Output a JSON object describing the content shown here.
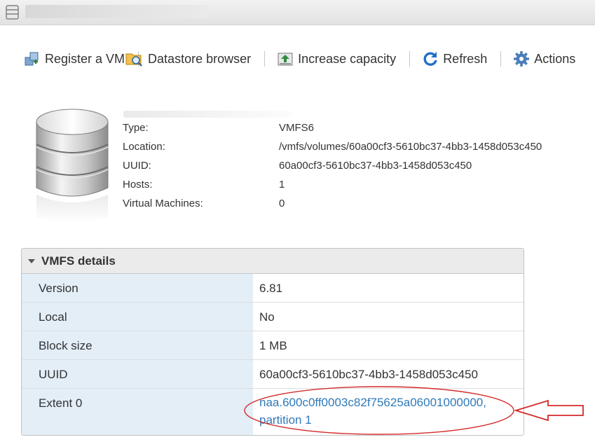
{
  "toolbar": {
    "register_vm": "Register a VM",
    "datastore_browser": "Datastore browser",
    "increase_capacity": "Increase capacity",
    "refresh": "Refresh",
    "actions": "Actions"
  },
  "summary": {
    "type_label": "Type:",
    "type_value": "VMFS6",
    "location_label": "Location:",
    "location_value": "/vmfs/volumes/60a00cf3-5610bc37-4bb3-1458d053c450",
    "uuid_label": "UUID:",
    "uuid_value": "60a00cf3-5610bc37-4bb3-1458d053c450",
    "hosts_label": "Hosts:",
    "hosts_value": "1",
    "vms_label": "Virtual Machines:",
    "vms_value": "0"
  },
  "vmfs_details": {
    "title": "VMFS details",
    "rows": [
      {
        "key": "Version",
        "value": "6.81"
      },
      {
        "key": "Local",
        "value": "No"
      },
      {
        "key": "Block size",
        "value": "1 MB"
      },
      {
        "key": "UUID",
        "value": "60a00cf3-5610bc37-4bb3-1458d053c450"
      },
      {
        "key": "Extent 0",
        "value_line1": "naa.600c0ff0003c82f75625a06001000000,",
        "value_line2": "partition 1"
      }
    ]
  },
  "colors": {
    "link": "#2f7ab9",
    "key_column_bg": "#e3eef7",
    "annotation": "#d42a2a"
  },
  "icons": [
    "datastore-icon",
    "register-vm-icon",
    "datastore-browser-icon",
    "increase-capacity-icon",
    "refresh-icon",
    "gear-icon",
    "annotation-ellipse",
    "annotation-arrow"
  ]
}
